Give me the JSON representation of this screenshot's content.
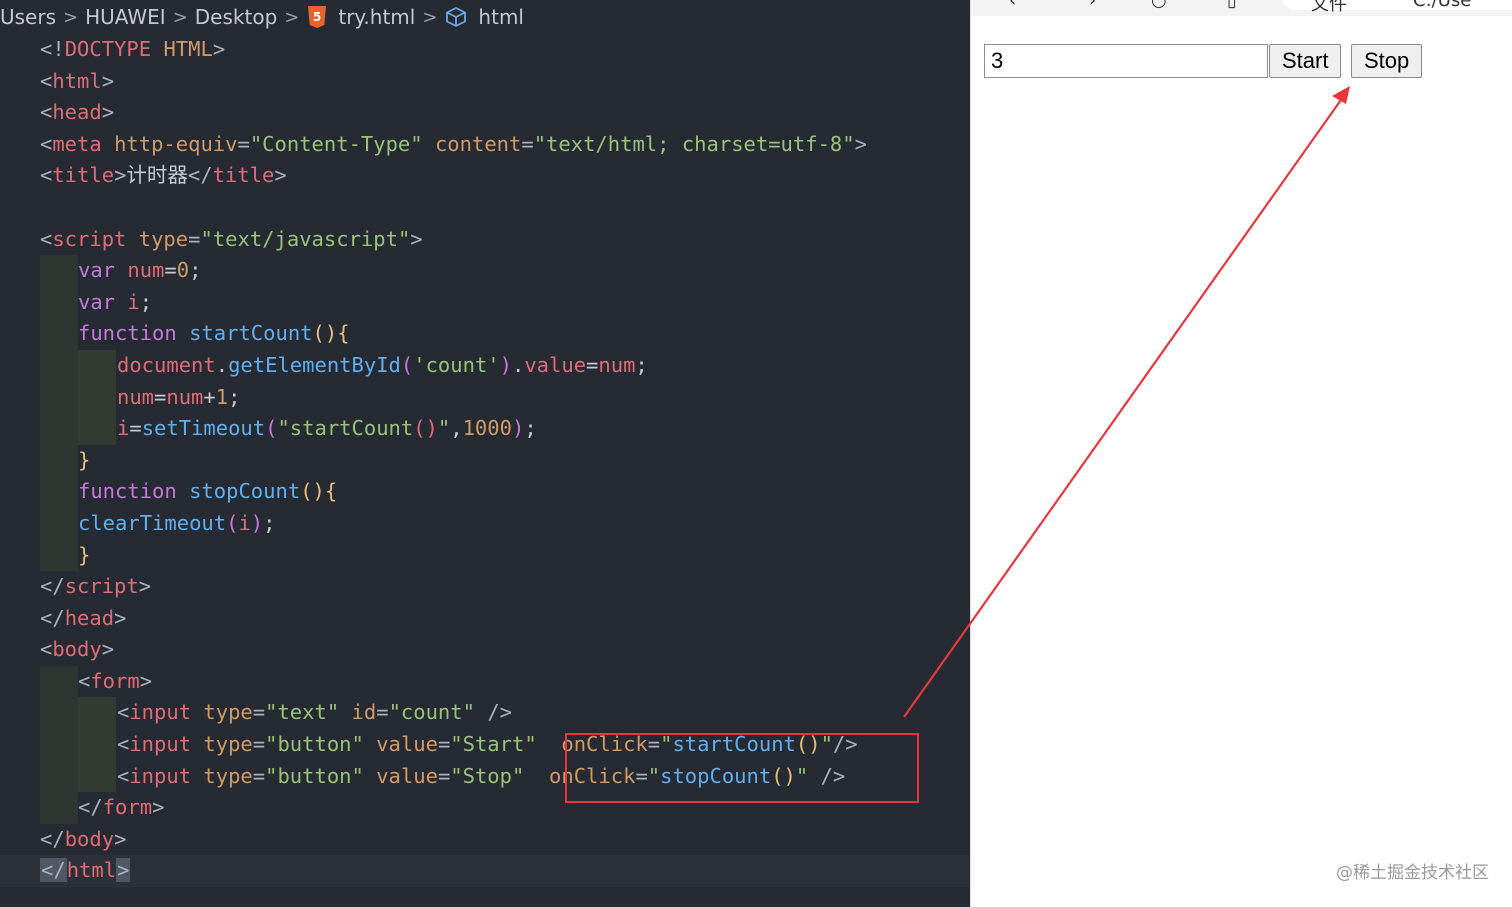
{
  "editor": {
    "breadcrumb": [
      "Users",
      "HUAWEI",
      "Desktop",
      "try.html",
      "html"
    ],
    "lines": [
      {
        "lvl": 0,
        "toks": [
          [
            "pun",
            "<!"
          ],
          [
            "tag",
            "DOCTYPE"
          ],
          [
            "pl",
            " "
          ],
          [
            "att",
            "HTML"
          ],
          [
            "pun",
            ">"
          ]
        ]
      },
      {
        "lvl": 0,
        "toks": [
          [
            "pun",
            "<"
          ],
          [
            "tag",
            "html"
          ],
          [
            "pun",
            ">"
          ]
        ]
      },
      {
        "lvl": 0,
        "toks": [
          [
            "pun",
            "<"
          ],
          [
            "tag",
            "head"
          ],
          [
            "pun",
            ">"
          ]
        ]
      },
      {
        "lvl": 0,
        "toks": [
          [
            "pun",
            "<"
          ],
          [
            "tag",
            "meta"
          ],
          [
            "pl",
            " "
          ],
          [
            "att",
            "http-equiv"
          ],
          [
            "pun",
            "="
          ],
          [
            "str",
            "\"Content-Type\""
          ],
          [
            "pl",
            " "
          ],
          [
            "att",
            "content"
          ],
          [
            "pun",
            "="
          ],
          [
            "str",
            "\"text/html; charset=utf-8\""
          ],
          [
            "pun",
            ">"
          ]
        ]
      },
      {
        "lvl": 0,
        "toks": [
          [
            "pun",
            "<"
          ],
          [
            "tag",
            "title"
          ],
          [
            "pun",
            ">"
          ],
          [
            "txtw",
            "计时器"
          ],
          [
            "pun",
            "</"
          ],
          [
            "tag",
            "title"
          ],
          [
            "pun",
            ">"
          ]
        ]
      },
      {
        "lvl": 0,
        "toks": []
      },
      {
        "lvl": 0,
        "toks": [
          [
            "pun",
            "<"
          ],
          [
            "tag",
            "script"
          ],
          [
            "pl",
            " "
          ],
          [
            "att",
            "type"
          ],
          [
            "pun",
            "="
          ],
          [
            "str",
            "\"text/javascript\""
          ],
          [
            "pun",
            ">"
          ]
        ]
      },
      {
        "lvl": 1,
        "toks": [
          [
            "kw",
            "var"
          ],
          [
            "pl",
            " "
          ],
          [
            "vr",
            "num"
          ],
          [
            "pl",
            "="
          ],
          [
            "num",
            "0"
          ],
          [
            "pl",
            ";"
          ]
        ]
      },
      {
        "lvl": 1,
        "toks": [
          [
            "kw",
            "var"
          ],
          [
            "pl",
            " "
          ],
          [
            "vr",
            "i"
          ],
          [
            "pl",
            ";"
          ]
        ]
      },
      {
        "lvl": 1,
        "toks": [
          [
            "kw",
            "function"
          ],
          [
            "pl",
            " "
          ],
          [
            "fn",
            "startCount"
          ],
          [
            "par",
            "()"
          ],
          [
            "par",
            "{"
          ]
        ]
      },
      {
        "lvl": 2,
        "toks": [
          [
            "vr",
            "document"
          ],
          [
            "pl",
            "."
          ],
          [
            "fn",
            "getElementById"
          ],
          [
            "parp",
            "("
          ],
          [
            "str",
            "'count'"
          ],
          [
            "parp",
            ")"
          ],
          [
            "pl",
            "."
          ],
          [
            "vr",
            "value"
          ],
          [
            "pl",
            "="
          ],
          [
            "vr",
            "num"
          ],
          [
            "pl",
            ";"
          ]
        ]
      },
      {
        "lvl": 2,
        "toks": [
          [
            "vr",
            "num"
          ],
          [
            "pl",
            "="
          ],
          [
            "vr",
            "num"
          ],
          [
            "pl",
            "+"
          ],
          [
            "num",
            "1"
          ],
          [
            "pl",
            ";"
          ]
        ]
      },
      {
        "lvl": 2,
        "toks": [
          [
            "vr",
            "i"
          ],
          [
            "pl",
            "="
          ],
          [
            "fn",
            "setTimeout"
          ],
          [
            "parp",
            "("
          ],
          [
            "str",
            "\"startCount"
          ],
          [
            "tag",
            "()"
          ],
          [
            "str",
            "\""
          ],
          [
            "pl",
            ","
          ],
          [
            "num",
            "1000"
          ],
          [
            "parp",
            ")"
          ],
          [
            "pl",
            ";"
          ]
        ]
      },
      {
        "lvl": 1,
        "toks": [
          [
            "par",
            "}"
          ]
        ]
      },
      {
        "lvl": 1,
        "toks": [
          [
            "kw",
            "function"
          ],
          [
            "pl",
            " "
          ],
          [
            "fn",
            "stopCount"
          ],
          [
            "par",
            "()"
          ],
          [
            "par",
            "{"
          ]
        ]
      },
      {
        "lvl": 1,
        "toks": [
          [
            "fn",
            "clearTimeout"
          ],
          [
            "parp",
            "("
          ],
          [
            "vr",
            "i"
          ],
          [
            "parp",
            ")"
          ],
          [
            "pl",
            ";"
          ]
        ]
      },
      {
        "lvl": 1,
        "toks": [
          [
            "par",
            "}"
          ]
        ]
      },
      {
        "lvl": 0,
        "toks": [
          [
            "pun",
            "</"
          ],
          [
            "tag",
            "script"
          ],
          [
            "pun",
            ">"
          ]
        ]
      },
      {
        "lvl": 0,
        "toks": [
          [
            "pun",
            "</"
          ],
          [
            "tag",
            "head"
          ],
          [
            "pun",
            ">"
          ]
        ]
      },
      {
        "lvl": 0,
        "toks": [
          [
            "pun",
            "<"
          ],
          [
            "tag",
            "body"
          ],
          [
            "pun",
            ">"
          ]
        ]
      },
      {
        "lvl": 1,
        "toks": [
          [
            "pun",
            "<"
          ],
          [
            "tag",
            "form"
          ],
          [
            "pun",
            ">"
          ]
        ]
      },
      {
        "lvl": 2,
        "toks": [
          [
            "pun",
            "<"
          ],
          [
            "tag",
            "input"
          ],
          [
            "pl",
            " "
          ],
          [
            "att",
            "type"
          ],
          [
            "pun",
            "="
          ],
          [
            "str",
            "\"text\""
          ],
          [
            "pl",
            " "
          ],
          [
            "att",
            "id"
          ],
          [
            "pun",
            "="
          ],
          [
            "str",
            "\"count\""
          ],
          [
            "pl",
            " "
          ],
          [
            "pun",
            "/>"
          ]
        ]
      },
      {
        "lvl": 2,
        "toks": [
          [
            "pun",
            "<"
          ],
          [
            "tag",
            "input"
          ],
          [
            "pl",
            " "
          ],
          [
            "att",
            "type"
          ],
          [
            "pun",
            "="
          ],
          [
            "str",
            "\"button\""
          ],
          [
            "pl",
            " "
          ],
          [
            "att",
            "value"
          ],
          [
            "pun",
            "="
          ],
          [
            "str",
            "\"Start\""
          ],
          [
            "pl",
            "  "
          ],
          [
            "att",
            "onClick"
          ],
          [
            "pun",
            "="
          ],
          [
            "str",
            "\""
          ],
          [
            "fn",
            "startCount"
          ],
          [
            "par",
            "()"
          ],
          [
            "str",
            "\""
          ],
          [
            "pun",
            "/>"
          ]
        ]
      },
      {
        "lvl": 2,
        "toks": [
          [
            "pun",
            "<"
          ],
          [
            "tag",
            "input"
          ],
          [
            "pl",
            " "
          ],
          [
            "att",
            "type"
          ],
          [
            "pun",
            "="
          ],
          [
            "str",
            "\"button\""
          ],
          [
            "pl",
            " "
          ],
          [
            "att",
            "value"
          ],
          [
            "pun",
            "="
          ],
          [
            "str",
            "\"Stop\""
          ],
          [
            "pl",
            "  "
          ],
          [
            "att",
            "onClick"
          ],
          [
            "pun",
            "="
          ],
          [
            "str",
            "\""
          ],
          [
            "fn",
            "stopCount"
          ],
          [
            "par",
            "()"
          ],
          [
            "str",
            "\""
          ],
          [
            "pl",
            " "
          ],
          [
            "pun",
            "/>"
          ]
        ]
      },
      {
        "lvl": 1,
        "toks": [
          [
            "pun",
            "</"
          ],
          [
            "tag",
            "form"
          ],
          [
            "pun",
            ">"
          ]
        ]
      },
      {
        "lvl": 0,
        "toks": [
          [
            "pun",
            "</"
          ],
          [
            "tag",
            "body"
          ],
          [
            "pun",
            ">"
          ]
        ]
      },
      {
        "lvl": 0,
        "current": true,
        "toks": [
          [
            "hl",
            "</"
          ],
          [
            "tag",
            "html"
          ],
          [
            "hl",
            ">"
          ]
        ]
      }
    ]
  },
  "browser": {
    "count_value": "3",
    "start_label": "Start",
    "stop_label": "Stop",
    "toolbar_text": "文件",
    "address_partial": "C:/Use"
  },
  "watermark": "@稀土掘金技术社区",
  "annotation_color": "#e6383c"
}
